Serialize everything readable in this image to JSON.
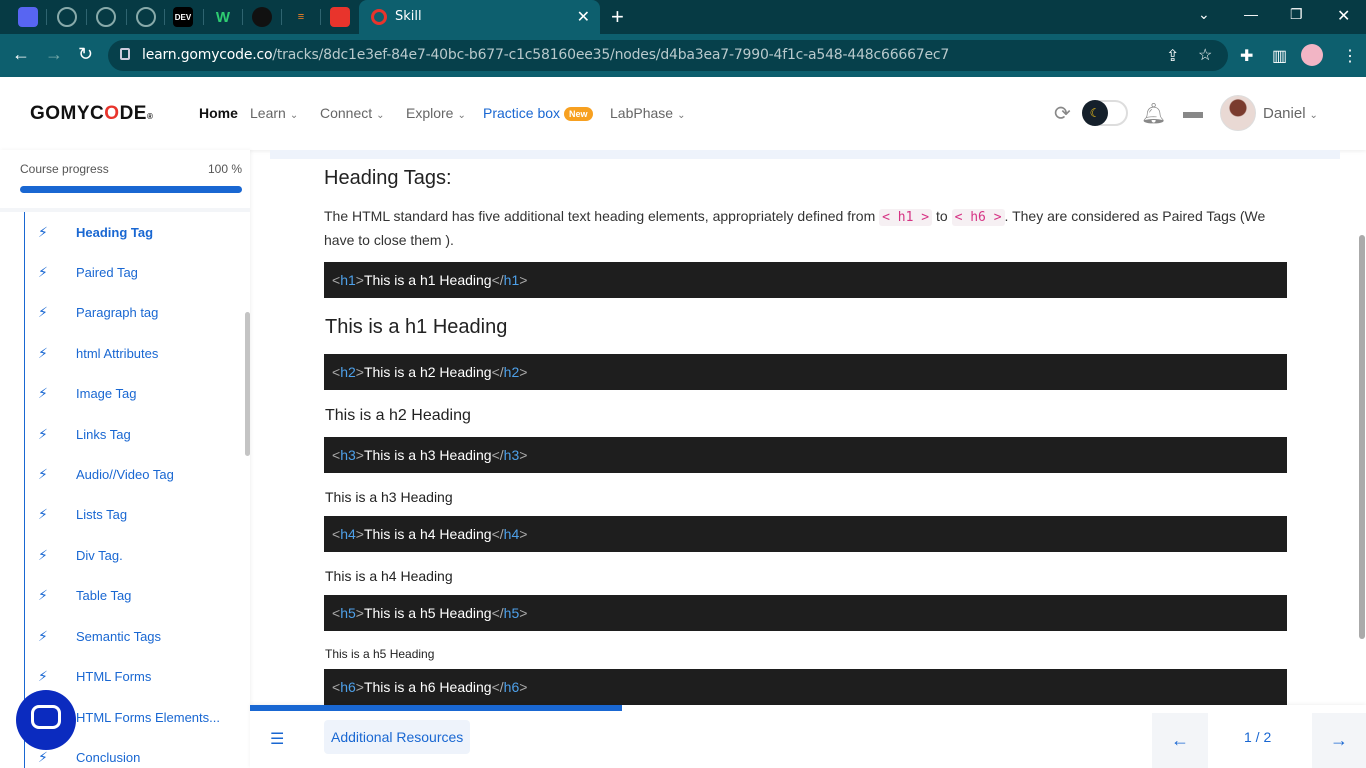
{
  "browser": {
    "tab_title": "Skill",
    "url_domain": "learn.gomycode.co",
    "url_path": "/tracks/8dc1e3ef-84e7-40bc-b677-c1c58160ee35/nodes/d4ba3ea7-7990-4f1c-a548-448c66667ec7",
    "pinned_tab_labels": [
      "DEV",
      "W"
    ]
  },
  "header": {
    "logo": {
      "part1": "GOMYC",
      "part2": "O",
      "part3": "DE",
      "mark": "®"
    },
    "nav": [
      {
        "label": "Home"
      },
      {
        "label": "Learn"
      },
      {
        "label": "Connect"
      },
      {
        "label": "Explore"
      },
      {
        "label": "Practice box",
        "badge": "New"
      },
      {
        "label": "LabPhase"
      }
    ],
    "username": "Daniel"
  },
  "sidebar": {
    "progress_label": "Course progress",
    "progress_value": "100 %",
    "progress_fraction": 1.0,
    "items": [
      {
        "label": "Heading Tag"
      },
      {
        "label": "Paired Tag"
      },
      {
        "label": "Paragraph tag"
      },
      {
        "label": "html Attributes"
      },
      {
        "label": "Image Tag"
      },
      {
        "label": "Links Tag"
      },
      {
        "label": "Audio//Video Tag"
      },
      {
        "label": "Lists Tag"
      },
      {
        "label": "Div Tag."
      },
      {
        "label": "Table Tag"
      },
      {
        "label": "Semantic Tags"
      },
      {
        "label": "HTML Forms"
      },
      {
        "label": "HTML Forms Elements..."
      },
      {
        "label": "Conclusion"
      }
    ]
  },
  "content": {
    "section_title": "Heading Tags:",
    "intro": {
      "before": "The HTML standard has five additional text heading elements, appropriately defined from ",
      "code1": "< h1 >",
      "middle": " to ",
      "code2": "< h6 >",
      "after": ". They are considered as Paired Tags (We have to close them )."
    },
    "examples": [
      {
        "tag": "h1",
        "text": "This is a h1 Heading"
      },
      {
        "tag": "h2",
        "text": "This is a h2 Heading"
      },
      {
        "tag": "h3",
        "text": "This is a h3 Heading"
      },
      {
        "tag": "h4",
        "text": "This is a h4 Heading"
      },
      {
        "tag": "h5",
        "text": "This is a h5 Heading"
      },
      {
        "tag": "h6",
        "text": "This is a h6 Heading"
      }
    ]
  },
  "bottom": {
    "resources_label": "Additional Resources",
    "pager": "1 / 2"
  },
  "colors": {
    "accent": "#1967d2",
    "brand_red": "#e8342c",
    "code_bg": "#1e1e1e",
    "tag_blue": "#4ea0e9"
  }
}
